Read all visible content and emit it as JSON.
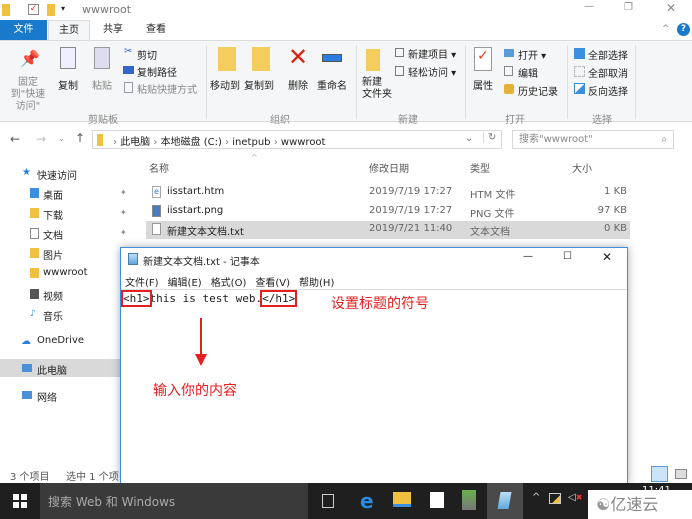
{
  "explorer": {
    "title": "wwwroot",
    "tabs": [
      "文件",
      "主页",
      "共享",
      "查看"
    ],
    "ribbon": {
      "clipboard": {
        "pin": "固定到\"快速访问\"",
        "copy": "复制",
        "paste": "粘贴",
        "cut": "剪切",
        "copy_path": "复制路径",
        "paste_shortcut": "粘贴快捷方式",
        "label": "剪贴板"
      },
      "organize": {
        "move_to": "移动到",
        "copy_to": "复制到",
        "delete": "删除",
        "rename": "重命名",
        "label": "组织"
      },
      "new": {
        "new_folder": "新建\n文件夹",
        "new_item": "新建项目 ▾",
        "easy_access": "轻松访问 ▾",
        "label": "新建"
      },
      "open": {
        "properties": "属性",
        "open": "打开 ▾",
        "edit": "编辑",
        "history": "历史记录",
        "label": "打开"
      },
      "select": {
        "select_all": "全部选择",
        "select_none": "全部取消",
        "invert": "反向选择",
        "label": "选择"
      }
    },
    "address": [
      "此电脑",
      "本地磁盘 (C:)",
      "inetpub",
      "wwwroot"
    ],
    "search_placeholder": "搜索\"wwwroot\"",
    "sidebar": [
      "快速访问",
      "桌面",
      "下载",
      "文档",
      "图片",
      "wwwroot",
      "视频",
      "音乐",
      "OneDrive",
      "此电脑",
      "网络"
    ],
    "columns": [
      "名称",
      "修改日期",
      "类型",
      "大小"
    ],
    "files": [
      {
        "name": "iisstart.htm",
        "date": "2019/7/19 17:27",
        "type": "HTM 文件",
        "size": "1 KB"
      },
      {
        "name": "iisstart.png",
        "date": "2019/7/19 17:27",
        "type": "PNG 文件",
        "size": "97 KB"
      },
      {
        "name": "新建文本文档.txt",
        "date": "2019/7/21 11:40",
        "type": "文本文档",
        "size": "0 KB"
      }
    ],
    "status": {
      "count": "3 个项目",
      "selected": "选中 1 个项"
    }
  },
  "notepad": {
    "title": "新建文本文档.txt - 记事本",
    "menu": [
      "文件(F)",
      "编辑(E)",
      "格式(O)",
      "查看(V)",
      "帮助(H)"
    ],
    "content": {
      "open_tag": "<h1>",
      "text": "this is test web.",
      "close_tag": "</h1>"
    }
  },
  "annotations": {
    "tag_note": "设置标题的符号",
    "content_note": "输入你的内容",
    "color": "#e4201f"
  },
  "taskbar": {
    "search": "搜索 Web 和 Windows",
    "clock": "11:41",
    "watermark": "亿速云"
  }
}
